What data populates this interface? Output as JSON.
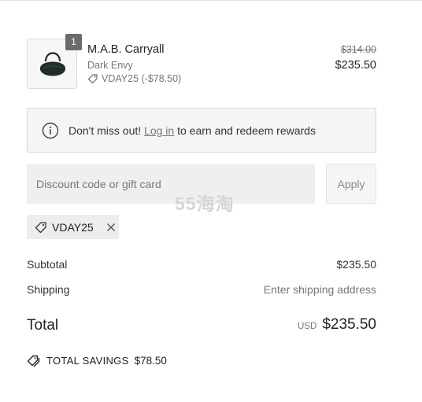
{
  "product": {
    "name": "M.A.B. Carryall",
    "variant": "Dark Envy",
    "discount": "VDAY25 (-$78.50)",
    "quantity": "1",
    "original_price": "$314.00",
    "price": "$235.50",
    "image_icon": "handbag-icon"
  },
  "rewards": {
    "prefix": "Don't miss out!",
    "link": "Log in",
    "suffix": "to earn and redeem rewards",
    "icon": "info-icon"
  },
  "discount_form": {
    "placeholder": "Discount code or gift card",
    "value": "",
    "apply_label": "Apply"
  },
  "applied_code": {
    "code": "VDAY25",
    "icon": "tag-icon",
    "remove_icon": "close-icon"
  },
  "watermark": "55海淘",
  "totals": {
    "subtotal_label": "Subtotal",
    "subtotal_value": "$235.50",
    "shipping_label": "Shipping",
    "shipping_value": "Enter shipping address",
    "total_label": "Total",
    "currency": "USD",
    "total_value": "$235.50"
  },
  "savings": {
    "label": "TOTAL SAVINGS",
    "amount": "$78.50",
    "icon": "double-tag-icon"
  },
  "colors": {
    "text": "#222222",
    "muted": "#777777",
    "banner_bg": "#f5f5f5",
    "input_bg": "#efefef",
    "badge_bg": "#6b6b6b"
  }
}
